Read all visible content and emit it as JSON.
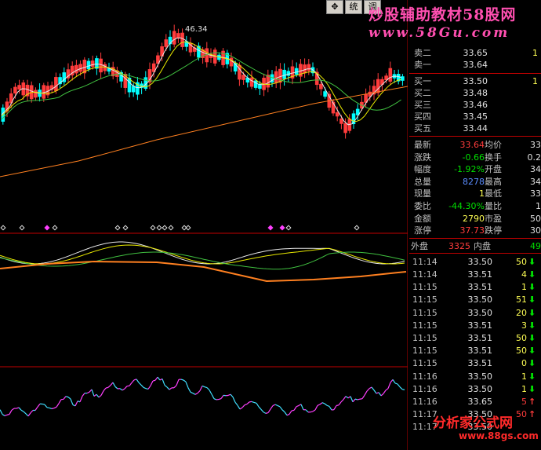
{
  "toolbar": {
    "move_icon": "✥",
    "tab_label": "统",
    "tab2_label": "调"
  },
  "watermark": {
    "line1": "炒股辅助教材58股网",
    "line2": "www.58Gu.com",
    "line3": "分析家公式网",
    "line4": "www.88gs.com"
  },
  "chart_annotations": {
    "high_label": "46.34"
  },
  "quote": {
    "asks": [
      {
        "label": "卖二",
        "price": "33.65",
        "vol": "1"
      },
      {
        "label": "卖一",
        "price": "33.64",
        "vol": ""
      }
    ],
    "bids": [
      {
        "label": "买一",
        "price": "33.50",
        "vol": "1"
      },
      {
        "label": "买二",
        "price": "33.48",
        "vol": ""
      },
      {
        "label": "买三",
        "price": "33.46",
        "vol": ""
      },
      {
        "label": "买四",
        "price": "33.45",
        "vol": ""
      },
      {
        "label": "买五",
        "price": "33.44",
        "vol": ""
      }
    ],
    "stats": [
      {
        "l1": "最新",
        "v1": "33.64",
        "c1": "red",
        "l2": "均价",
        "v2": "33"
      },
      {
        "l1": "涨跌",
        "v1": "-0.66",
        "c1": "green",
        "l2": "换手",
        "v2": "0.2"
      },
      {
        "l1": "幅度",
        "v1": "-1.92%",
        "c1": "green",
        "l2": "开盘",
        "v2": "34"
      },
      {
        "l1": "总量",
        "v1": "8278",
        "c1": "blue",
        "l2": "最高",
        "v2": "34"
      },
      {
        "l1": "现量",
        "v1": "1",
        "c1": "yel",
        "l2": "最低",
        "v2": "33"
      },
      {
        "l1": "委比",
        "v1": "-44.30%",
        "c1": "green",
        "l2": "量比",
        "v2": "1"
      },
      {
        "l1": "金额",
        "v1": "2790",
        "c1": "yel",
        "l2": "市盈",
        "v2": "50"
      },
      {
        "l1": "涨停",
        "v1": "37.73",
        "c1": "red",
        "l2": "跌停",
        "v2": "30"
      }
    ],
    "outer_label": "外盘",
    "outer_value": "3325",
    "inner_label": "内盘",
    "inner_value": "49"
  },
  "ticks": [
    {
      "time": "11:14",
      "price": "33.50",
      "vol": "50",
      "dir": "down"
    },
    {
      "time": "11:14",
      "price": "33.51",
      "vol": "4",
      "dir": "down"
    },
    {
      "time": "11:15",
      "price": "33.51",
      "vol": "1",
      "dir": "down"
    },
    {
      "time": "11:15",
      "price": "33.50",
      "vol": "51",
      "dir": "down"
    },
    {
      "time": "11:15",
      "price": "33.50",
      "vol": "20",
      "dir": "down"
    },
    {
      "time": "11:15",
      "price": "33.51",
      "vol": "3",
      "dir": "down"
    },
    {
      "time": "11:15",
      "price": "33.51",
      "vol": "50",
      "dir": "down"
    },
    {
      "time": "11:15",
      "price": "33.51",
      "vol": "50",
      "dir": "down"
    },
    {
      "time": "11:15",
      "price": "33.51",
      "vol": "0",
      "dir": "down"
    },
    {
      "time": "11:16",
      "price": "33.50",
      "vol": "1",
      "dir": "down"
    },
    {
      "time": "11:16",
      "price": "33.50",
      "vol": "1",
      "dir": "down"
    },
    {
      "time": "11:16",
      "price": "33.65",
      "vol": "5",
      "dir": "up"
    },
    {
      "time": "11:17",
      "price": "33.50",
      "vol": "50",
      "dir": "up"
    },
    {
      "time": "11:17",
      "price": "33.50",
      "vol": "",
      "dir": ""
    }
  ],
  "colors": {
    "up": "#ff3c3c",
    "down": "#00ffff",
    "ma_white": "#e8e8e8",
    "ma_yellow": "#e8e800",
    "ma_green": "#40c040",
    "ma_orange": "#ff8020",
    "osc_pink": "#ff40ff",
    "osc_cyan": "#40e0ff"
  }
}
